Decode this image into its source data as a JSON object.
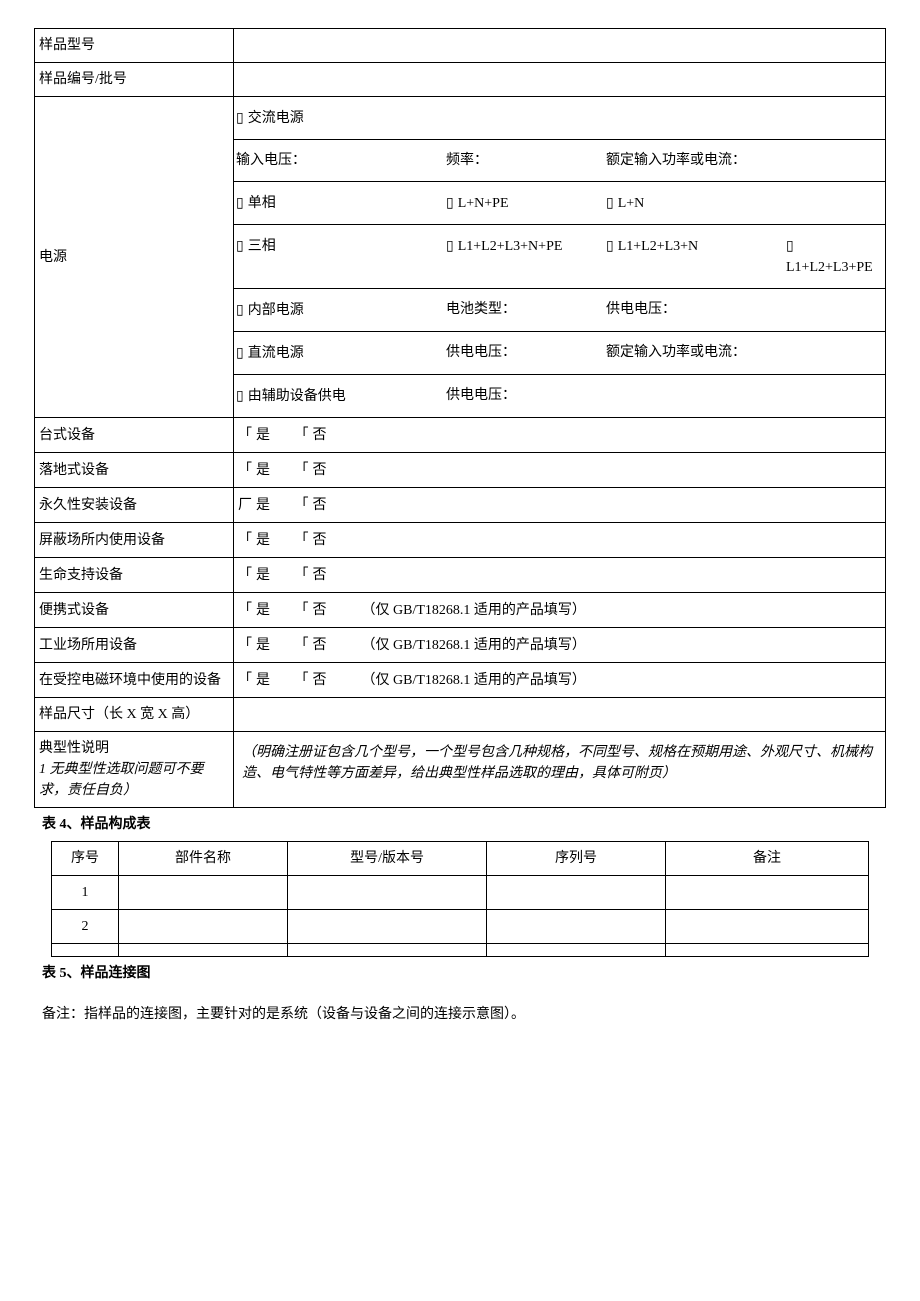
{
  "table3": {
    "row_model": "样品型号",
    "row_serial": "样品编号/批号",
    "row_power_label": "电源",
    "ac": "交流电源",
    "in_voltage": "输入电压：",
    "freq": "频率：",
    "rated_power": "额定输入功率或电流：",
    "single_phase": "单相",
    "ln_pe": "L+N+PE",
    "ln": "L+N",
    "three_phase": "三相",
    "l123npe": "L1+L2+L3+N+PE",
    "l123n": "L1+L2+L3+N",
    "l123pe": "L1+L2+L3+PE",
    "internal": "内部电源",
    "battery_type": "电池类型：",
    "supply_voltage": "供电电压：",
    "dc": "直流电源",
    "rated_power2": "额定输入功率或电流：",
    "aux": "由辅助设备供电",
    "yes": "是",
    "no": "否",
    "gb_note": "（仅 GB/T18268.1 适用的产品填写）",
    "desktop": "台式设备",
    "floor": "落地式设备",
    "permanent": "永久性安装设备",
    "shielded": "屏蔽场所内使用设备",
    "life_support": "生命支持设备",
    "portable": "便携式设备",
    "industrial": "工业场所用设备",
    "controlled_em": "在受控电磁环境中使用的设备",
    "dimensions": "样品尺寸（长 X 宽 X 高）",
    "typical_label_1": "典型性说明",
    "typical_label_2": "1 无典型性选取问题可不要求，责任自负）",
    "typical_desc": "（明确注册证包含几个型号，一个型号包含几种规格，不同型号、规格在预期用途、外观尺寸、机械构造、电气特性等方面差异，给出典型性样品选取的理由，具体可附页）"
  },
  "table4_title": "表 4、样品构成表",
  "table4": {
    "h_seq": "序号",
    "h_part": "部件名称",
    "h_model": "型号/版本号",
    "h_serial": "序列号",
    "h_remark": "备注",
    "rows": [
      "1",
      "2",
      ""
    ]
  },
  "table5_title": "表 5、样品连接图",
  "table5_remark": "备注：指样品的连接图，主要针对的是系统（设备与设备之间的连接示意图）。"
}
